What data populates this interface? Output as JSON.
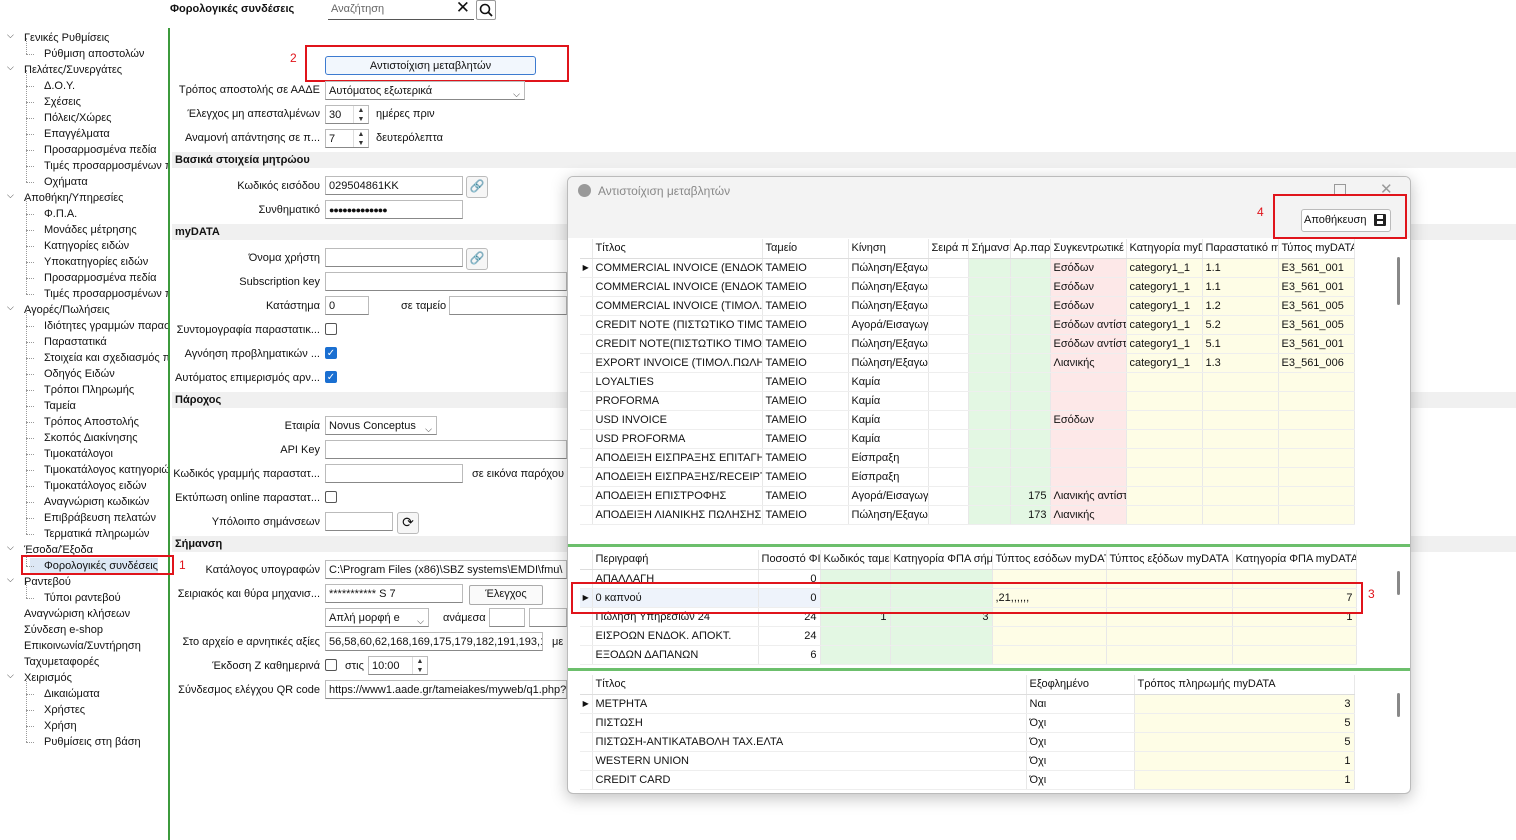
{
  "header": {
    "title": "Φορολογικές συνδέσεις",
    "search_placeholder": "Αναζήτηση"
  },
  "sidebar": {
    "items": [
      {
        "label": "Γενικές Ρυθμίσεις",
        "level": 0,
        "expanded": true
      },
      {
        "label": "Ρύθμιση αποστολών",
        "level": 1
      },
      {
        "label": "Πελάτες/Συνεργάτες",
        "level": 0,
        "expanded": true
      },
      {
        "label": "Δ.Ο.Υ.",
        "level": 1
      },
      {
        "label": "Σχέσεις",
        "level": 1
      },
      {
        "label": "Πόλεις/Χώρες",
        "level": 1
      },
      {
        "label": "Επαγγέλματα",
        "level": 1
      },
      {
        "label": "Προσαρμοσμένα πεδία",
        "level": 1
      },
      {
        "label": "Τιμές προσαρμοσμένων π",
        "level": 1
      },
      {
        "label": "Οχήματα",
        "level": 1
      },
      {
        "label": "Αποθήκη/Υπηρεσίες",
        "level": 0,
        "expanded": true
      },
      {
        "label": "Φ.Π.Α.",
        "level": 1
      },
      {
        "label": "Μονάδες μέτρησης",
        "level": 1
      },
      {
        "label": "Κατηγορίες ειδών",
        "level": 1
      },
      {
        "label": "Υποκατηγορίες ειδών",
        "level": 1
      },
      {
        "label": "Προσαρμοσμένα πεδία",
        "level": 1
      },
      {
        "label": "Τιμές προσαρμοσμένων π",
        "level": 1
      },
      {
        "label": "Αγορές/Πωλήσεις",
        "level": 0,
        "expanded": true
      },
      {
        "label": "Ιδιότητες γραμμών παρασ",
        "level": 1
      },
      {
        "label": "Παραστατικά",
        "level": 1
      },
      {
        "label": "Στοιχεία και σχεδιασμός π",
        "level": 1
      },
      {
        "label": "Οδηγός Ειδών",
        "level": 1
      },
      {
        "label": "Τρόποι Πληρωμής",
        "level": 1
      },
      {
        "label": "Ταμεία",
        "level": 1
      },
      {
        "label": "Τρόπος Αποστολής",
        "level": 1
      },
      {
        "label": "Σκοπός Διακίνησης",
        "level": 1
      },
      {
        "label": "Τιμοκατάλογοι",
        "level": 1
      },
      {
        "label": "Τιμοκατάλογος κατηγοριώ",
        "level": 1
      },
      {
        "label": "Τιμοκατάλογος ειδών",
        "level": 1
      },
      {
        "label": "Αναγνώριση κωδικών",
        "level": 1
      },
      {
        "label": "Επιβράβευση πελατών",
        "level": 1
      },
      {
        "label": "Τερματικά πληρωμών",
        "level": 1
      },
      {
        "label": "Έσοδα/Έξοδα",
        "level": 0,
        "expanded": true
      },
      {
        "label": "Φορολογικές συνδέσεις",
        "level": 1,
        "selected": true
      },
      {
        "label": "Ραντεβού",
        "level": 0,
        "expanded": true
      },
      {
        "label": "Τύποι ραντεβού",
        "level": 1
      },
      {
        "label": "Αναγνώριση κλήσεων",
        "level": 0
      },
      {
        "label": "Σύνδεση e-shop",
        "level": 0
      },
      {
        "label": "Επικοινωνία/Συντήρηση",
        "level": 0
      },
      {
        "label": "Ταχυμεταφορές",
        "level": 0
      },
      {
        "label": "Χειρισμός",
        "level": 0,
        "expanded": true
      },
      {
        "label": "Δικαιώματα",
        "level": 1
      },
      {
        "label": "Χρήστες",
        "level": 1
      },
      {
        "label": "Χρήση",
        "level": 1
      },
      {
        "label": "Ρυθμίσεις στη βάση",
        "level": 1
      }
    ]
  },
  "annotations": {
    "n1": "1",
    "n2": "2",
    "n3": "3",
    "n4": "4"
  },
  "form": {
    "map_button": "Αντιστοίχιση μεταβλητών",
    "send_mode_label": "Τρόπος αποστολής σε ΑΑΔΕ",
    "send_mode_value": "Αυτόματος εξωτερικά",
    "check_unsent_label": "Έλεγχος μη απεσταλμένων",
    "check_unsent_value": "30",
    "check_unsent_unit": "ημέρες πριν",
    "wait_label": "Αναμονή απάντησης σε π...",
    "wait_value": "7",
    "wait_unit": "δευτερόλεπτα",
    "basic_section": "Βασικά στοιχεία μητρώου",
    "login_code_label": "Κωδικός εισόδου",
    "login_code_value": "029504861KK",
    "password_label": "Συνθηματικό",
    "password_value": "●●●●●●●●●●●●●",
    "mydata_section": "myDATA",
    "username_label": "Όνομα χρήστη",
    "subscription_label": "Subscription key",
    "store_label": "Κατάστημα",
    "store_value": "0",
    "register_label": "σε ταμείο",
    "abbrev_label": "Συντομογραφία παραστατικ...",
    "ignore_label": "Αγνόηση προβληματικών ...",
    "auto_split_label": "Αυτόματος επιμερισμός αρν...",
    "provider_section": "Πάροχος",
    "company_label": "Εταιρία",
    "company_value": "Novus Conceptus",
    "apikey_label": "API Key",
    "doc_line_label": "Κωδικός γραμμής παραστατ...",
    "provider_image_label": "σε εικόνα παρόχου",
    "online_print_label": "Εκτύπωση online παραστατ...",
    "balance_label": "Υπόλοιπο σημάνσεων",
    "marking_section": "Σήμανση",
    "sig_dir_label": "Κατάλογος υπογραφών",
    "sig_dir_value": "C:\\Program Files (x86)\\SBZ systems\\EMDI\\fmu\\",
    "serial_label": "Σειριακός και θύρα μηχανισ...",
    "serial_value": "*********** S 7",
    "check_button": "Έλεγχος",
    "format_value": "Απλή μορφή e",
    "between_label": "ανάμεσα",
    "neg_values_label": "Στο αρχείο e αρνητικές αξίες",
    "neg_values_value": "56,58,60,62,168,169,175,179,182,191,193,1",
    "neg_values_suffix": "με",
    "z_label": "Έκδοση Ζ καθημερινά",
    "z_at_label": "στις",
    "z_time": "10:00",
    "qr_label": "Σύνδεσμος ελέγχου QR code",
    "qr_value": "https://www1.aade.gr/tameiakes/myweb/q1.php?"
  },
  "dialog": {
    "title": "Αντιστοίχιση μεταβλητών",
    "save_button": "Αποθήκευση",
    "grid1": {
      "columns": [
        "Τίτλος",
        "Ταμείο",
        "Κίνηση",
        "Σειρά π",
        "Σήμανσ",
        "Αρ.παρ",
        "Συγκεντρωτικέ",
        "Κατηγορία myD",
        "Παραστατικό m",
        "Τύπος myDATA"
      ],
      "rows": [
        [
          "COMMERCIAL INVOICE (ΕΝΔΟΚΟΙΝ",
          "ΤΑΜΕΙΟ",
          "Πώληση/Εξαγωγ",
          "",
          "",
          "",
          "Εσόδων",
          "category1_1",
          "1.1",
          "E3_561_001"
        ],
        [
          "COMMERCIAL INVOICE (ΕΝΔΟΚΟΙΝ",
          "ΤΑΜΕΙΟ",
          "Πώληση/Εξαγωγ",
          "",
          "",
          "",
          "Εσόδων",
          "category1_1",
          "1.1",
          "E3_561_001"
        ],
        [
          "COMMERCIAL INVOICE (ΤΙΜΟΛ.ΠΩ",
          "ΤΑΜΕΙΟ",
          "Πώληση/Εξαγωγ",
          "",
          "",
          "",
          "Εσόδων",
          "category1_1",
          "1.2",
          "E3_561_005"
        ],
        [
          "CREDIT NOTE (ΠΙΣΤΩΤΙΚΟ ΤΙΜΟΛΟ",
          "ΤΑΜΕΙΟ",
          "Αγορά/Εισαγωγ",
          "",
          "",
          "",
          "Εσόδων αντίστ",
          "category1_1",
          "5.2",
          "E3_561_005"
        ],
        [
          "CREDIT NOTE(ΠΙΣΤΩΤΙΚΟ ΤΙΜΟΛΟΙ",
          "ΤΑΜΕΙΟ",
          "Πώληση/Εξαγωγ",
          "",
          "",
          "",
          "Εσόδων αντίστ",
          "category1_1",
          "5.1",
          "E3_561_001"
        ],
        [
          "EXPORT INVOICE (ΤΙΜΟΛ.ΠΩΛΗΣΗ",
          "ΤΑΜΕΙΟ",
          "Πώληση/Εξαγωγ",
          "",
          "",
          "",
          "Λιανικής",
          "category1_1",
          "1.3",
          "E3_561_006"
        ],
        [
          "LOYALTIES",
          "ΤΑΜΕΙΟ",
          "Καμία",
          "",
          "",
          "",
          "",
          "",
          "",
          ""
        ],
        [
          "PROFORMA",
          "ΤΑΜΕΙΟ",
          "Καμία",
          "",
          "",
          "",
          "",
          "",
          "",
          ""
        ],
        [
          "USD INVOICE",
          "ΤΑΜΕΙΟ",
          "Καμία",
          "",
          "",
          "",
          "Εσόδων",
          "",
          "",
          ""
        ],
        [
          "USD PROFORMA",
          "ΤΑΜΕΙΟ",
          "Καμία",
          "",
          "",
          "",
          "",
          "",
          "",
          ""
        ],
        [
          "ΑΠΟΔΕΙΞΗ ΕΙΣΠΡΑΞΗΣ ΕΠΙΤΑΓΗ",
          "ΤΑΜΕΙΟ",
          "Είσπραξη",
          "",
          "",
          "",
          "",
          "",
          "",
          ""
        ],
        [
          "ΑΠΟΔΕΙΞΗ ΕΙΣΠΡΑΞΗΣ/RECEIPT",
          "ΤΑΜΕΙΟ",
          "Είσπραξη",
          "",
          "",
          "",
          "",
          "",
          "",
          ""
        ],
        [
          "ΑΠΟΔΕΙΞΗ ΕΠΙΣΤΡΟΦΗΣ",
          "ΤΑΜΕΙΟ",
          "Αγορά/Εισαγωγ",
          "",
          "",
          "175",
          "Λιανικής αντίστ",
          "",
          "",
          ""
        ],
        [
          "ΑΠΟΔΕΙΞΗ ΛΙΑΝΙΚΗΣ ΠΩΛΗΣΗΣ",
          "ΤΑΜΕΙΟ",
          "Πώληση/Εξαγωγ",
          "",
          "",
          "173",
          "Λιανικής",
          "",
          "",
          ""
        ]
      ]
    },
    "grid2": {
      "columns": [
        "Περιγραφή",
        "Ποσοστό ΦΙ",
        "Κωδικός ταμει",
        "Κατηγορία ΦΠΑ σήμ",
        "Τύπτος εσόδων myDAT",
        "Τύπτος εξόδων myDATA",
        "Κατηγορία ΦΠΑ myDATA"
      ],
      "rows": [
        [
          "ΑΠΑΛΛΑΓΗ",
          "0",
          "",
          "",
          "",
          "",
          ""
        ],
        [
          "0 καπνού",
          "0",
          "",
          "",
          ",21,,,,,,",
          "",
          "7"
        ],
        [
          "Πώληση Υπηρεσιών 24",
          "24",
          "1",
          "3",
          "",
          "",
          "1"
        ],
        [
          "ΕΙΣΡΟΩΝ ΕΝΔΟΚ. ΑΠΟΚΤ.",
          "24",
          "",
          "",
          "",
          "",
          ""
        ],
        [
          "ΕΞΟΔΩΝ ΔΑΠΑΝΩΝ",
          "6",
          "",
          "",
          "",
          "",
          ""
        ]
      ]
    },
    "grid3": {
      "columns": [
        "Τίτλος",
        "Εξοφλημένο",
        "Τρόπος πληρωμής myDATA"
      ],
      "rows": [
        [
          "ΜΕΤΡΗΤΑ",
          "Ναι",
          "3"
        ],
        [
          "ΠΙΣΤΩΣΗ",
          "Όχι",
          "5"
        ],
        [
          "ΠΙΣΤΩΣΗ-ΑΝΤΙΚΑΤΑΒΟΛΗ ΤΑΧ.ΕΛΤΑ",
          "Όχι",
          "5"
        ],
        [
          "WESTERN UNION",
          "Όχι",
          "1"
        ],
        [
          "CREDIT CARD",
          "Όχι",
          "1"
        ]
      ]
    }
  }
}
